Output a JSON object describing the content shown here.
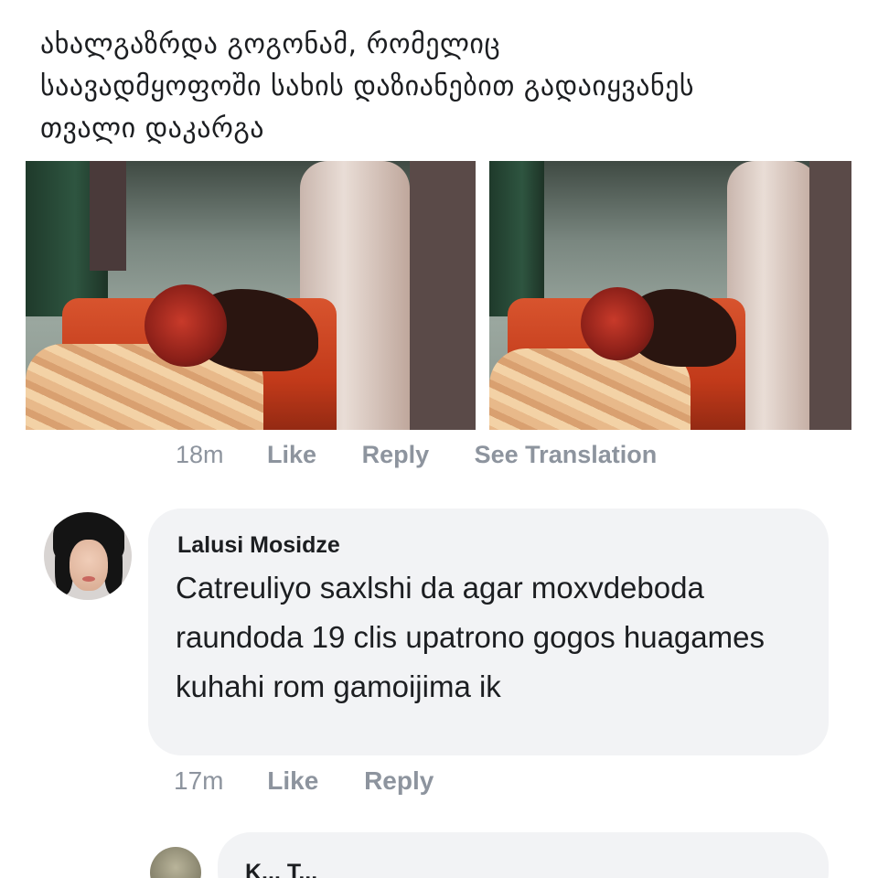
{
  "post": {
    "text_line1": "ახალგაზრდა გოგონამ, რომელიც",
    "text_line2": "საავადმყოფოში სახის დაზიანებით გადაიყვანეს",
    "text_line3": "თვალი დაკარგა"
  },
  "post_actions": {
    "time": "18m",
    "like": "Like",
    "reply": "Reply",
    "see_translation": "See Translation"
  },
  "comment": {
    "author": "Lalusi Mosidze",
    "body": "Catreuliyo saxlshi da agar moxvdeboda raundoda 19 clis upatrono gogos huagames kuhahi rom gamoijima ik",
    "time": "17m",
    "like": "Like",
    "reply": "Reply"
  },
  "next_comment": {
    "author_partial": "K... T..."
  }
}
